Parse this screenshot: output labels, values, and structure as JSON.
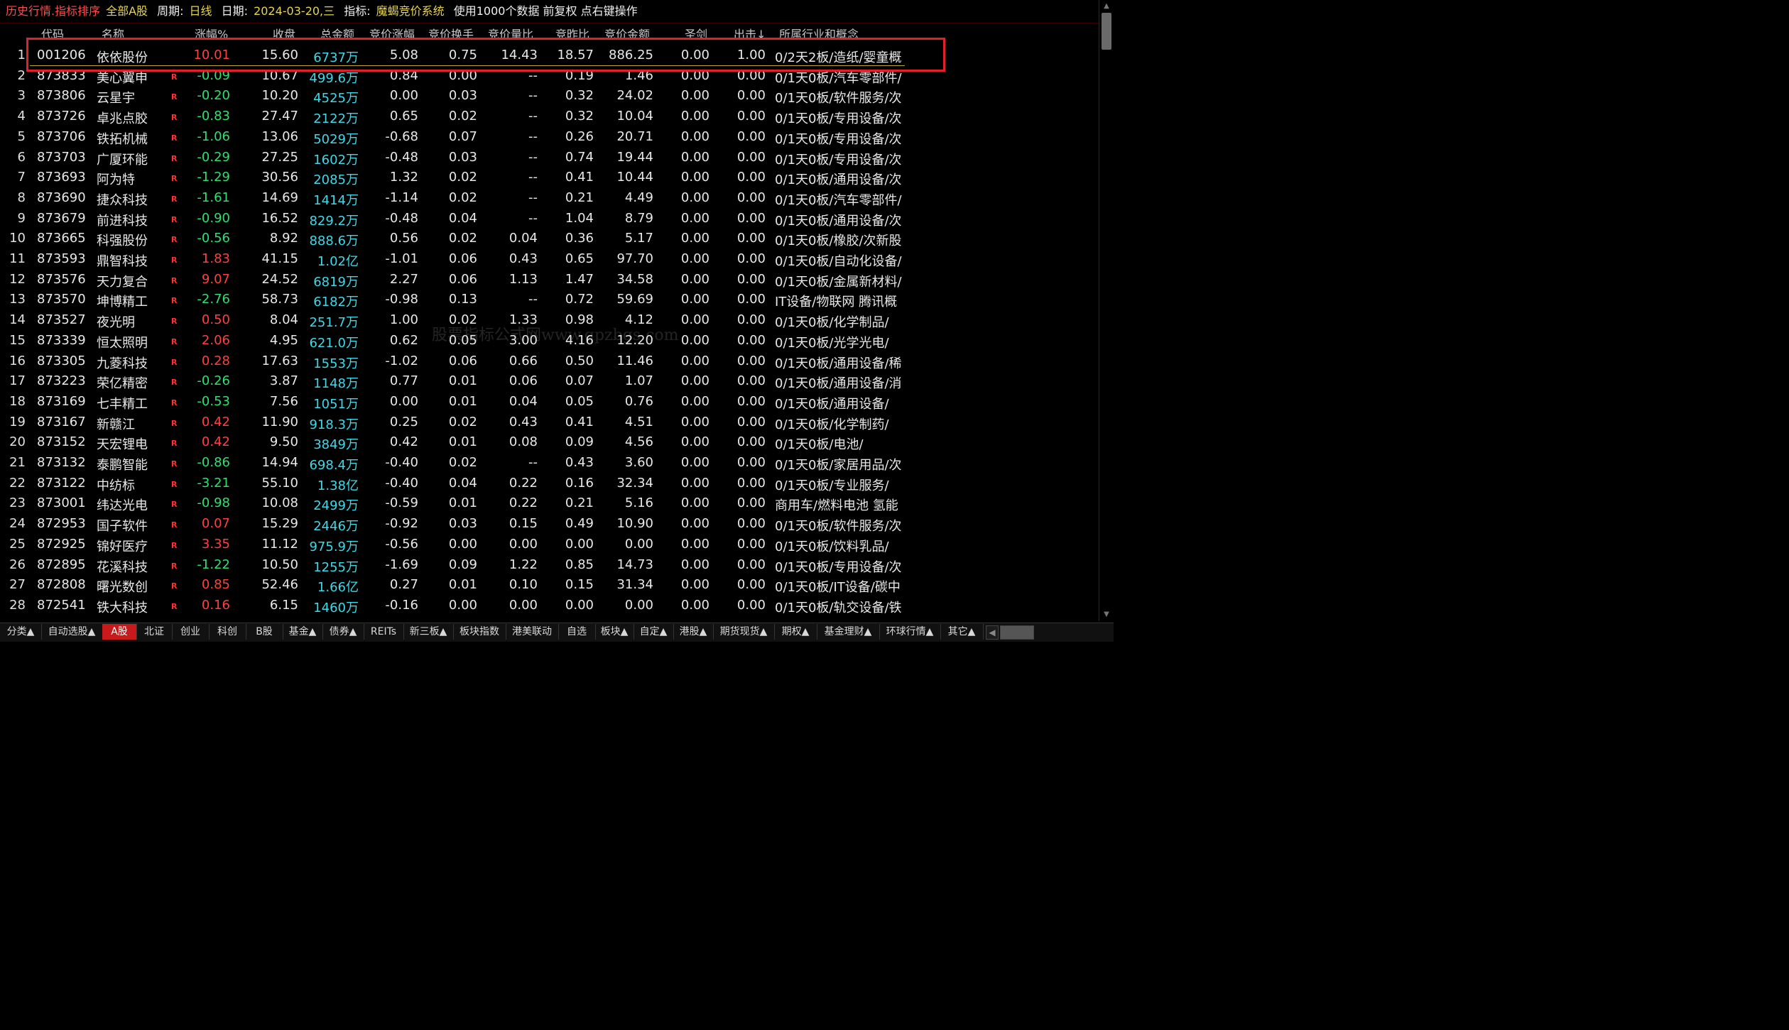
{
  "titlebar": {
    "part1": "历史行情.指标排序",
    "part2": "全部A股",
    "period_label": "周期:",
    "period_value": "日线",
    "date_label": "日期:",
    "date_value": "2024-03-20,三",
    "indicator_label": "指标:",
    "indicator_value": "魔蝎竞价系统",
    "note": "使用1000个数据 前复权 点右键操作"
  },
  "columns": [
    "代码",
    "名称",
    "涨幅%",
    "收盘",
    "总金额",
    "竞价涨幅",
    "竞价换手",
    "竞价量比",
    "竞昨比",
    "竞价金额",
    "圣剑",
    "出击↓",
    "所属行业和概念"
  ],
  "rows": [
    {
      "idx": "1",
      "code": "001206",
      "name": "依依股份",
      "r": "",
      "chg": "10.01",
      "dir": "up",
      "close": "15.60",
      "amount": "6737万",
      "bidchg": "5.08",
      "bidturn": "0.75",
      "bidvol": "14.43",
      "bidratio": "18.57",
      "bidamt": "886.25",
      "sj": "0.00",
      "cj": "1.00",
      "ind": "0/2天2板/造纸/婴童概"
    },
    {
      "idx": "2",
      "code": "873833",
      "name": "美心翼申",
      "r": "R",
      "chg": "-0.09",
      "dir": "down",
      "close": "10.67",
      "amount": "499.6万",
      "bidchg": "0.84",
      "bidturn": "0.00",
      "bidvol": "--",
      "bidratio": "0.19",
      "bidamt": "1.46",
      "sj": "0.00",
      "cj": "0.00",
      "ind": "0/1天0板/汽车零部件/"
    },
    {
      "idx": "3",
      "code": "873806",
      "name": "云星宇",
      "r": "R",
      "chg": "-0.20",
      "dir": "down",
      "close": "10.20",
      "amount": "4525万",
      "bidchg": "0.00",
      "bidturn": "0.03",
      "bidvol": "--",
      "bidratio": "0.32",
      "bidamt": "24.02",
      "sj": "0.00",
      "cj": "0.00",
      "ind": "0/1天0板/软件服务/次"
    },
    {
      "idx": "4",
      "code": "873726",
      "name": "卓兆点胶",
      "r": "R",
      "chg": "-0.83",
      "dir": "down",
      "close": "27.47",
      "amount": "2122万",
      "bidchg": "0.65",
      "bidturn": "0.02",
      "bidvol": "--",
      "bidratio": "0.32",
      "bidamt": "10.04",
      "sj": "0.00",
      "cj": "0.00",
      "ind": "0/1天0板/专用设备/次"
    },
    {
      "idx": "5",
      "code": "873706",
      "name": "铁拓机械",
      "r": "R",
      "chg": "-1.06",
      "dir": "down",
      "close": "13.06",
      "amount": "5029万",
      "bidchg": "-0.68",
      "bidturn": "0.07",
      "bidvol": "--",
      "bidratio": "0.26",
      "bidamt": "20.71",
      "sj": "0.00",
      "cj": "0.00",
      "ind": "0/1天0板/专用设备/次"
    },
    {
      "idx": "6",
      "code": "873703",
      "name": "广厦环能",
      "r": "R",
      "chg": "-0.29",
      "dir": "down",
      "close": "27.25",
      "amount": "1602万",
      "bidchg": "-0.48",
      "bidturn": "0.03",
      "bidvol": "--",
      "bidratio": "0.74",
      "bidamt": "19.44",
      "sj": "0.00",
      "cj": "0.00",
      "ind": "0/1天0板/专用设备/次"
    },
    {
      "idx": "7",
      "code": "873693",
      "name": "阿为特",
      "r": "R",
      "chg": "-1.29",
      "dir": "down",
      "close": "30.56",
      "amount": "2085万",
      "bidchg": "1.32",
      "bidturn": "0.02",
      "bidvol": "--",
      "bidratio": "0.41",
      "bidamt": "10.44",
      "sj": "0.00",
      "cj": "0.00",
      "ind": "0/1天0板/通用设备/次"
    },
    {
      "idx": "8",
      "code": "873690",
      "name": "捷众科技",
      "r": "R",
      "chg": "-1.61",
      "dir": "down",
      "close": "14.69",
      "amount": "1414万",
      "bidchg": "-1.14",
      "bidturn": "0.02",
      "bidvol": "--",
      "bidratio": "0.21",
      "bidamt": "4.49",
      "sj": "0.00",
      "cj": "0.00",
      "ind": "0/1天0板/汽车零部件/"
    },
    {
      "idx": "9",
      "code": "873679",
      "name": "前进科技",
      "r": "R",
      "chg": "-0.90",
      "dir": "down",
      "close": "16.52",
      "amount": "829.2万",
      "bidchg": "-0.48",
      "bidturn": "0.04",
      "bidvol": "--",
      "bidratio": "1.04",
      "bidamt": "8.79",
      "sj": "0.00",
      "cj": "0.00",
      "ind": "0/1天0板/通用设备/次"
    },
    {
      "idx": "10",
      "code": "873665",
      "name": "科强股份",
      "r": "R",
      "chg": "-0.56",
      "dir": "down",
      "close": "8.92",
      "amount": "888.6万",
      "bidchg": "0.56",
      "bidturn": "0.02",
      "bidvol": "0.04",
      "bidratio": "0.36",
      "bidamt": "5.17",
      "sj": "0.00",
      "cj": "0.00",
      "ind": "0/1天0板/橡胶/次新股"
    },
    {
      "idx": "11",
      "code": "873593",
      "name": "鼎智科技",
      "r": "R",
      "chg": "1.83",
      "dir": "up",
      "close": "41.15",
      "amount": "1.02亿",
      "bidchg": "-1.01",
      "bidturn": "0.06",
      "bidvol": "0.43",
      "bidratio": "0.65",
      "bidamt": "97.70",
      "sj": "0.00",
      "cj": "0.00",
      "ind": "0/1天0板/自动化设备/"
    },
    {
      "idx": "12",
      "code": "873576",
      "name": "天力复合",
      "r": "R",
      "chg": "9.07",
      "dir": "up",
      "close": "24.52",
      "amount": "6819万",
      "bidchg": "2.27",
      "bidturn": "0.06",
      "bidvol": "1.13",
      "bidratio": "1.47",
      "bidamt": "34.58",
      "sj": "0.00",
      "cj": "0.00",
      "ind": "0/1天0板/金属新材料/"
    },
    {
      "idx": "13",
      "code": "873570",
      "name": "坤博精工",
      "r": "R",
      "chg": "-2.76",
      "dir": "down",
      "close": "58.73",
      "amount": "6182万",
      "bidchg": "-0.98",
      "bidturn": "0.13",
      "bidvol": "--",
      "bidratio": "0.72",
      "bidamt": "59.69",
      "sj": "0.00",
      "cj": "0.00",
      "ind": "IT设备/物联网 腾讯概"
    },
    {
      "idx": "14",
      "code": "873527",
      "name": "夜光明",
      "r": "R",
      "chg": "0.50",
      "dir": "up",
      "close": "8.04",
      "amount": "251.7万",
      "bidchg": "1.00",
      "bidturn": "0.02",
      "bidvol": "1.33",
      "bidratio": "0.98",
      "bidamt": "4.12",
      "sj": "0.00",
      "cj": "0.00",
      "ind": "0/1天0板/化学制品/"
    },
    {
      "idx": "15",
      "code": "873339",
      "name": "恒太照明",
      "r": "R",
      "chg": "2.06",
      "dir": "up",
      "close": "4.95",
      "amount": "621.0万",
      "bidchg": "0.62",
      "bidturn": "0.05",
      "bidvol": "3.00",
      "bidratio": "4.16",
      "bidamt": "12.20",
      "sj": "0.00",
      "cj": "0.00",
      "ind": "0/1天0板/光学光电/"
    },
    {
      "idx": "16",
      "code": "873305",
      "name": "九菱科技",
      "r": "R",
      "chg": "0.28",
      "dir": "up",
      "close": "17.63",
      "amount": "1553万",
      "bidchg": "-1.02",
      "bidturn": "0.06",
      "bidvol": "0.66",
      "bidratio": "0.50",
      "bidamt": "11.46",
      "sj": "0.00",
      "cj": "0.00",
      "ind": "0/1天0板/通用设备/稀"
    },
    {
      "idx": "17",
      "code": "873223",
      "name": "荣亿精密",
      "r": "R",
      "chg": "-0.26",
      "dir": "down",
      "close": "3.87",
      "amount": "1148万",
      "bidchg": "0.77",
      "bidturn": "0.01",
      "bidvol": "0.06",
      "bidratio": "0.07",
      "bidamt": "1.07",
      "sj": "0.00",
      "cj": "0.00",
      "ind": "0/1天0板/通用设备/消"
    },
    {
      "idx": "18",
      "code": "873169",
      "name": "七丰精工",
      "r": "R",
      "chg": "-0.53",
      "dir": "down",
      "close": "7.56",
      "amount": "1051万",
      "bidchg": "0.00",
      "bidturn": "0.01",
      "bidvol": "0.04",
      "bidratio": "0.05",
      "bidamt": "0.76",
      "sj": "0.00",
      "cj": "0.00",
      "ind": "0/1天0板/通用设备/"
    },
    {
      "idx": "19",
      "code": "873167",
      "name": "新赣江",
      "r": "R",
      "chg": "0.42",
      "dir": "up",
      "close": "11.90",
      "amount": "918.3万",
      "bidchg": "0.25",
      "bidturn": "0.02",
      "bidvol": "0.43",
      "bidratio": "0.41",
      "bidamt": "4.51",
      "sj": "0.00",
      "cj": "0.00",
      "ind": "0/1天0板/化学制药/"
    },
    {
      "idx": "20",
      "code": "873152",
      "name": "天宏锂电",
      "r": "R",
      "chg": "0.42",
      "dir": "up",
      "close": "9.50",
      "amount": "3849万",
      "bidchg": "0.42",
      "bidturn": "0.01",
      "bidvol": "0.08",
      "bidratio": "0.09",
      "bidamt": "4.56",
      "sj": "0.00",
      "cj": "0.00",
      "ind": "0/1天0板/电池/"
    },
    {
      "idx": "21",
      "code": "873132",
      "name": "泰鹏智能",
      "r": "R",
      "chg": "-0.86",
      "dir": "down",
      "close": "14.94",
      "amount": "698.4万",
      "bidchg": "-0.40",
      "bidturn": "0.02",
      "bidvol": "--",
      "bidratio": "0.43",
      "bidamt": "3.60",
      "sj": "0.00",
      "cj": "0.00",
      "ind": "0/1天0板/家居用品/次"
    },
    {
      "idx": "22",
      "code": "873122",
      "name": "中纺标",
      "r": "R",
      "chg": "-3.21",
      "dir": "down",
      "close": "55.10",
      "amount": "1.38亿",
      "bidchg": "-0.40",
      "bidturn": "0.04",
      "bidvol": "0.22",
      "bidratio": "0.16",
      "bidamt": "32.34",
      "sj": "0.00",
      "cj": "0.00",
      "ind": "0/1天0板/专业服务/"
    },
    {
      "idx": "23",
      "code": "873001",
      "name": "纬达光电",
      "r": "R",
      "chg": "-0.98",
      "dir": "down",
      "close": "10.08",
      "amount": "2499万",
      "bidchg": "-0.59",
      "bidturn": "0.01",
      "bidvol": "0.22",
      "bidratio": "0.21",
      "bidamt": "5.16",
      "sj": "0.00",
      "cj": "0.00",
      "ind": "商用车/燃料电池 氢能"
    },
    {
      "idx": "24",
      "code": "872953",
      "name": "国子软件",
      "r": "R",
      "chg": "0.07",
      "dir": "up",
      "close": "15.29",
      "amount": "2446万",
      "bidchg": "-0.92",
      "bidturn": "0.03",
      "bidvol": "0.15",
      "bidratio": "0.49",
      "bidamt": "10.90",
      "sj": "0.00",
      "cj": "0.00",
      "ind": "0/1天0板/软件服务/次"
    },
    {
      "idx": "25",
      "code": "872925",
      "name": "锦好医疗",
      "r": "R",
      "chg": "3.35",
      "dir": "up",
      "close": "11.12",
      "amount": "975.9万",
      "bidchg": "-0.56",
      "bidturn": "0.00",
      "bidvol": "0.00",
      "bidratio": "0.00",
      "bidamt": "0.00",
      "sj": "0.00",
      "cj": "0.00",
      "ind": "0/1天0板/饮料乳品/"
    },
    {
      "idx": "26",
      "code": "872895",
      "name": "花溪科技",
      "r": "R",
      "chg": "-1.22",
      "dir": "down",
      "close": "10.50",
      "amount": "1255万",
      "bidchg": "-1.69",
      "bidturn": "0.09",
      "bidvol": "1.22",
      "bidratio": "0.85",
      "bidamt": "14.73",
      "sj": "0.00",
      "cj": "0.00",
      "ind": "0/1天0板/专用设备/次"
    },
    {
      "idx": "27",
      "code": "872808",
      "name": "曙光数创",
      "r": "R",
      "chg": "0.85",
      "dir": "up",
      "close": "52.46",
      "amount": "1.66亿",
      "bidchg": "0.27",
      "bidturn": "0.01",
      "bidvol": "0.10",
      "bidratio": "0.15",
      "bidamt": "31.34",
      "sj": "0.00",
      "cj": "0.00",
      "ind": "0/1天0板/IT设备/碳中"
    },
    {
      "idx": "28",
      "code": "872541",
      "name": "铁大科技",
      "r": "R",
      "chg": "0.16",
      "dir": "up",
      "close": "6.15",
      "amount": "1460万",
      "bidchg": "-0.16",
      "bidturn": "0.00",
      "bidvol": "0.00",
      "bidratio": "0.00",
      "bidamt": "0.00",
      "sj": "0.00",
      "cj": "0.00",
      "ind": "0/1天0板/轨交设备/铁"
    }
  ],
  "watermark": "股票指标公式网www.gpzbgs.com",
  "tabs": [
    "分类▲",
    "自动选股▲",
    "A股",
    "北证",
    "创业",
    "科创",
    "B股",
    "基金▲",
    "债券▲",
    "REITs",
    "新三板▲",
    "板块指数",
    "港美联动",
    "自选",
    "板块▲",
    "自定▲",
    "港股▲",
    "期货现货▲",
    "期权▲",
    "基金理财▲",
    "环球行情▲",
    "其它▲"
  ],
  "active_tab": "A股",
  "tab_scroll_left": "◀",
  "colors": {
    "up": "#ff4040",
    "down": "#2fe070",
    "amount": "#40d8e8",
    "highlight": "#e0202a",
    "active_tab": "#c81a1a"
  },
  "icons": {
    "scroll_up": "triangle-up-icon",
    "scroll_down": "triangle-down-icon"
  }
}
